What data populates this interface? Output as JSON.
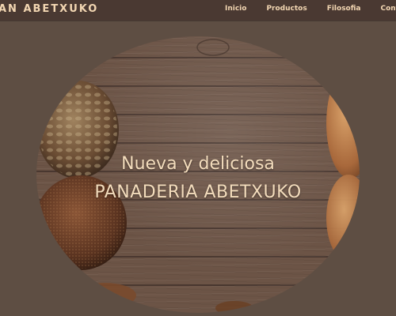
{
  "header": {
    "brand": "AN ABETXUKO",
    "nav": [
      {
        "label": "Inicio"
      },
      {
        "label": "Productos"
      },
      {
        "label": "Filosofia"
      },
      {
        "label": "Contact"
      }
    ]
  },
  "hero": {
    "line1": "Nueva y deliciosa",
    "line2": "PANADERIA ABETXUKO"
  },
  "colors": {
    "page_bg": "#5e4e43",
    "header_bg": "#4a3932",
    "text_accent": "#f2d6b2"
  },
  "icons": [
    "seeded-bread-image",
    "rye-bread-image",
    "crusty-bread-image"
  ]
}
